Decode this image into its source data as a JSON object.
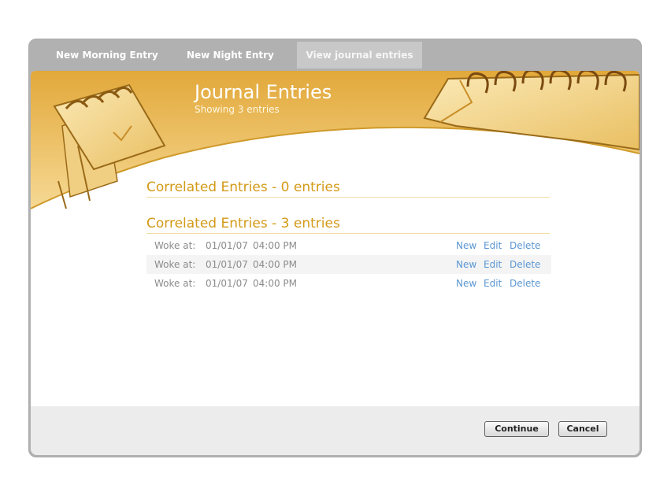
{
  "tabs": [
    {
      "label": "New Morning Entry"
    },
    {
      "label": "New Night Entry"
    },
    {
      "label": "View journal entries"
    }
  ],
  "header": {
    "title": "Journal Entries",
    "subtitle": "Showing 3 entries"
  },
  "sections": [
    {
      "title": "Correlated Entries - 0 entries"
    },
    {
      "title": "Correlated Entries - 3 entries"
    }
  ],
  "entries": [
    {
      "label": "Woke at:",
      "date": "01/01/07",
      "time": "04:00 PM",
      "actions": {
        "new": "New",
        "edit": "Edit",
        "delete": "Delete"
      }
    },
    {
      "label": "Woke at:",
      "date": "01/01/07",
      "time": "04:00 PM",
      "actions": {
        "new": "New",
        "edit": "Edit",
        "delete": "Delete"
      }
    },
    {
      "label": "Woke at:",
      "date": "01/01/07",
      "time": "04:00 PM",
      "actions": {
        "new": "New",
        "edit": "Edit",
        "delete": "Delete"
      }
    }
  ],
  "footer": {
    "continue_label": "Continue",
    "cancel_label": "Cancel"
  },
  "colors": {
    "accent": "#d39a17",
    "banner": "#e9b546",
    "link": "#5b97d2",
    "tabbar": "#b1b1b1"
  },
  "icons": [
    "notepad-illustration",
    "spiral-notebook-illustration"
  ]
}
